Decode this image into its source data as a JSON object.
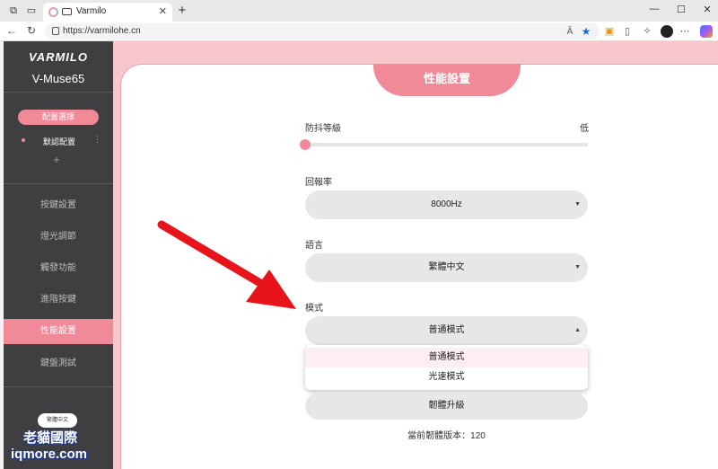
{
  "browser": {
    "tab_title": "Varmilo",
    "url": "https://varmilohe.cn",
    "read_aloud_icon": "Â",
    "window_min": "—",
    "window_max": "☐",
    "window_close": "✕"
  },
  "sidebar": {
    "logo": "VARMILO",
    "model": "V-Muse65",
    "config_label": "配置選擇",
    "profile": "默認配置",
    "profile_more": "⋮",
    "add": "+",
    "menu": [
      {
        "label": "按鍵設置"
      },
      {
        "label": "燈光調節"
      },
      {
        "label": "觸發功能"
      },
      {
        "label": "進階按鍵"
      },
      {
        "label": "性能設置"
      },
      {
        "label": "鍵盤測試"
      }
    ],
    "language_btn": "繁體中文"
  },
  "main": {
    "section_title": "性能設置",
    "debounce": {
      "label": "防抖等級",
      "value_label": "低",
      "level": 0.0
    },
    "polling": {
      "label": "回報率",
      "value": "8000Hz"
    },
    "language": {
      "label": "語言",
      "value": "繁體中文"
    },
    "mode": {
      "label": "模式",
      "value": "普通模式",
      "options": [
        "普通模式",
        "光速模式"
      ]
    },
    "upgrade_button": "韌體升級",
    "firmware_version": "當前韌體版本：120"
  },
  "watermark": {
    "line1": "老貓國際",
    "line2": "iqmore.com"
  },
  "colors": {
    "accent": "#f08a98",
    "sidebar_bg": "#3f3f42",
    "arrow": "#e8141b"
  }
}
